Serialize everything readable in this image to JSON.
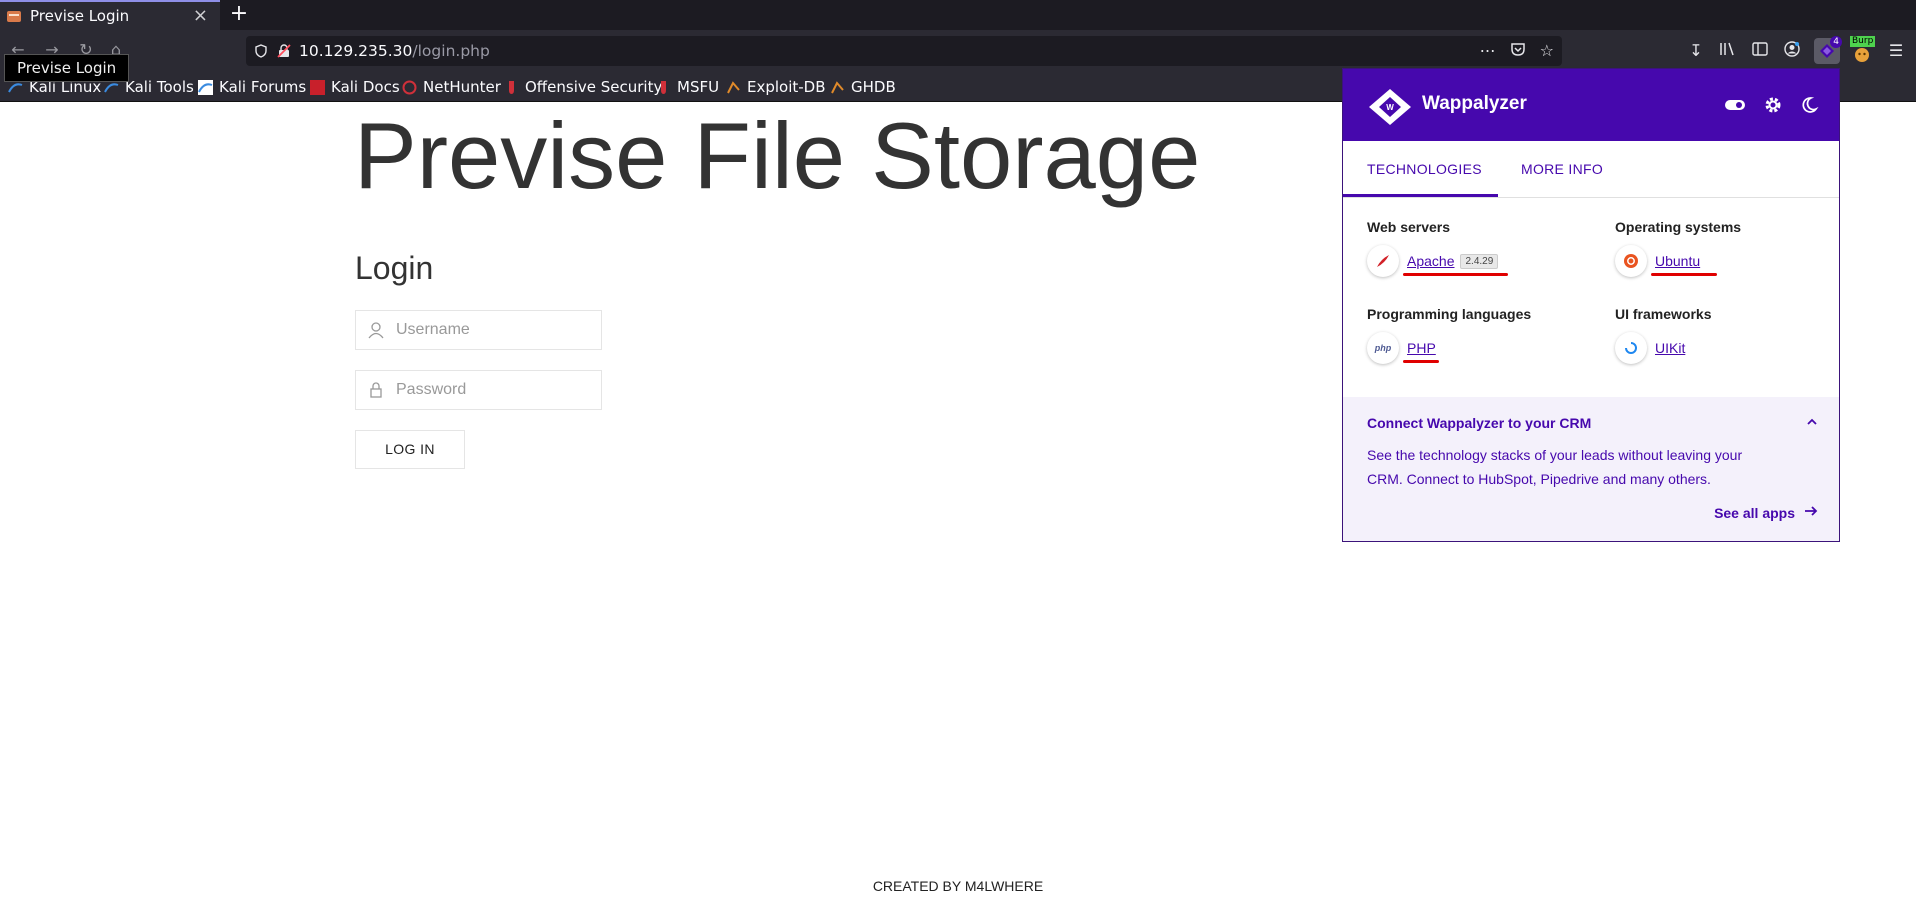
{
  "browser": {
    "tab_title": "Previse Login",
    "tab_close": "×",
    "new_tab": "+",
    "url_host": "10.129.235.30",
    "url_path": "/login.php",
    "tooltip": "Previse Login",
    "extension_badge": "4",
    "burp_label": "Burp",
    "bookmarks": [
      {
        "label": "Kali Linux"
      },
      {
        "label": "Kali Tools"
      },
      {
        "label": "Kali Forums"
      },
      {
        "label": "Kali Docs"
      },
      {
        "label": "NetHunter"
      },
      {
        "label": "Offensive Security"
      },
      {
        "label": "MSFU"
      },
      {
        "label": "Exploit-DB"
      },
      {
        "label": "GHDB"
      }
    ]
  },
  "page": {
    "title": "Previse File Storage",
    "login_heading": "Login",
    "username_placeholder": "Username",
    "password_placeholder": "Password",
    "login_button": "LOG IN",
    "footer": "CREATED BY M4LWHERE"
  },
  "wappalyzer": {
    "brand": "Wappalyzer",
    "tabs": [
      "TECHNOLOGIES",
      "MORE INFO"
    ],
    "categories": [
      {
        "title": "Web servers",
        "tech": "Apache",
        "version": "2.4.29",
        "icon": "apache-feather-icon"
      },
      {
        "title": "Operating systems",
        "tech": "Ubuntu",
        "icon": "ubuntu-icon"
      },
      {
        "title": "Programming languages",
        "tech": "PHP",
        "icon": "php-icon"
      },
      {
        "title": "UI frameworks",
        "tech": "UIKit",
        "icon": "uikit-icon"
      }
    ],
    "php_icon_text": "php",
    "crm": {
      "title": "Connect Wappalyzer to your CRM",
      "text": "See the technology stacks of your leads without leaving your CRM. Connect to HubSpot, Pipedrive and many others.",
      "link": "See all apps"
    },
    "colors": {
      "brand": "#4608ad",
      "underline": "#e00000",
      "crm_bg": "#f4f1fb"
    }
  }
}
